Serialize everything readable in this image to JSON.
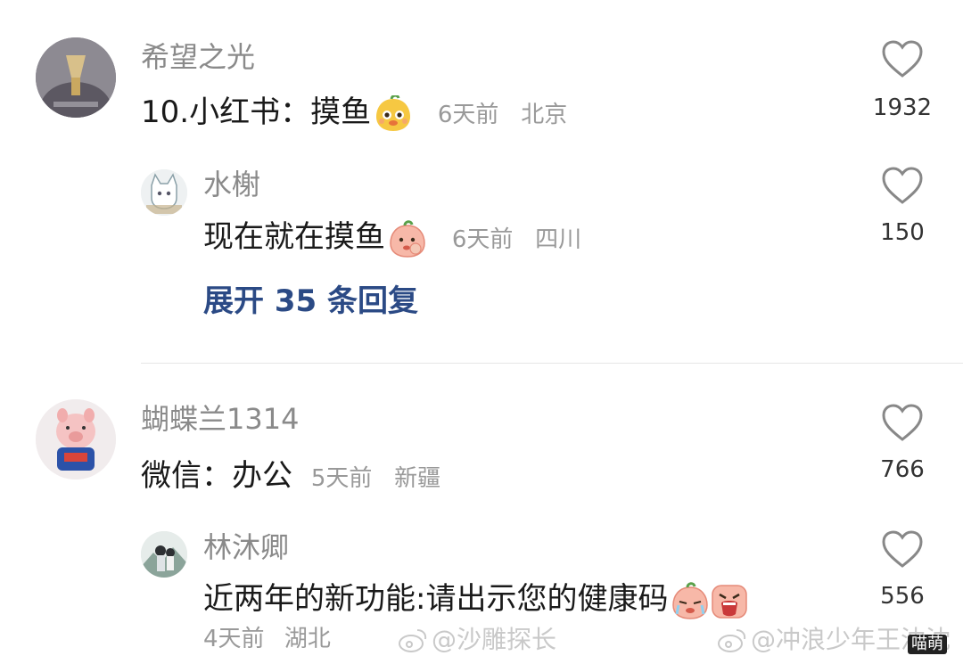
{
  "comments": [
    {
      "username": "希望之光",
      "text": "10.小红书：摸鱼",
      "time": "6天前",
      "location": "北京",
      "likes": "1932",
      "emoji": "yellow-face-emoji",
      "reply": {
        "username": "水榭",
        "text": "现在就在摸鱼",
        "time": "6天前",
        "location": "四川",
        "likes": "150",
        "emoji": "peach-thinking-emoji"
      },
      "expand_label": "展开 35 条回复"
    },
    {
      "username": "蝴蝶兰1314",
      "text": "微信：办公",
      "time": "5天前",
      "location": "新疆",
      "likes": "766",
      "reply": {
        "username": "林沐卿",
        "text": "近两年的新功能:请出示您的健康码",
        "time": "4天前",
        "location": "湖北",
        "likes": "556",
        "emoji": [
          "peach-crying-emoji",
          "peach-shouting-emoji"
        ]
      }
    }
  ],
  "watermarks": [
    "@沙雕探长",
    "@冲浪少年王沈沈",
    "喵萌"
  ],
  "colors": {
    "username": "#8a8a8a",
    "link": "#2b4a85",
    "meta": "#999999"
  }
}
